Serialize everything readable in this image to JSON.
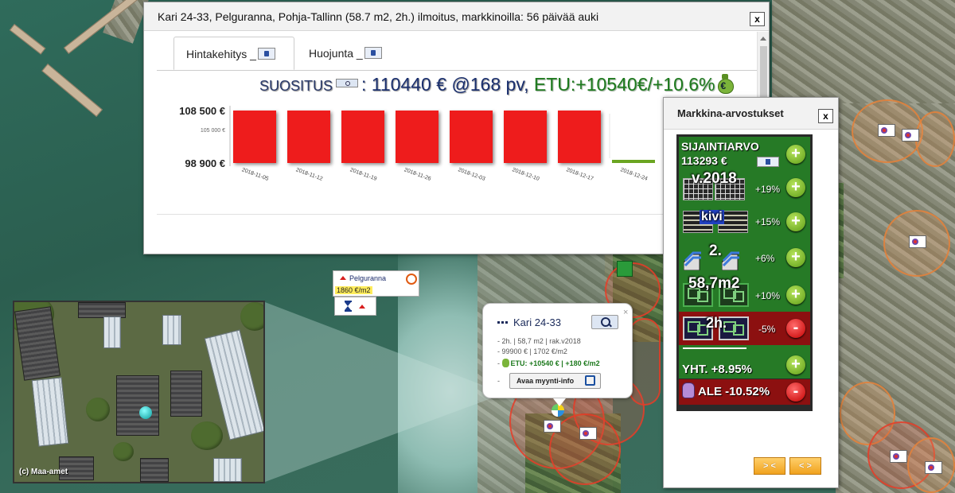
{
  "popup": {
    "title": "Kari 24-33, Pelguranna, Pohja-Tallinn (58.7 m2, 2h.) ilmoitus, markkinoilla: 56 päivää auki",
    "close": "x",
    "tabs": [
      {
        "label": "Hintakehitys _"
      },
      {
        "label": "Huojunta _"
      }
    ],
    "suositus_label": "SUOSITUS",
    "recommendation": "110440 € @168 pv",
    "separator": ",",
    "etu": "ETU:+10540€/+10.6%"
  },
  "chart_data": {
    "type": "bar",
    "categories": [
      "2018-11-05",
      "2018-11-12",
      "2018-11-19",
      "2018-11-26",
      "2018-12-03",
      "2018-12-10",
      "2018-12-17",
      "2018-12-24"
    ],
    "series": [
      {
        "values": [
          108500,
          108500,
          108500,
          108500,
          108500,
          108500,
          108500,
          98900
        ]
      }
    ],
    "ylim": [
      98900,
      108500
    ],
    "ytick_labels": [
      "108 500 €",
      "105 000 €",
      "98 900 €"
    ],
    "ytick_values": [
      108500,
      105000,
      98900
    ],
    "colors": {
      "bar": "#ee1c1c",
      "last_bar": "#6aa521"
    }
  },
  "market": {
    "title": "Markkina-arvostukset",
    "close": "x",
    "sijainti_label": "SIJAINTIARVO",
    "sijainti_value": "113293 €",
    "rows": [
      {
        "badge": "v.2018",
        "pct": "+19%",
        "sign": "+"
      },
      {
        "badge": "kivi",
        "pct": "+15%",
        "sign": "+"
      },
      {
        "badge": "2.",
        "pct": "+6%",
        "sign": "+"
      },
      {
        "badge": "58,7m2",
        "pct": "+10%",
        "sign": "+"
      },
      {
        "badge": "2h.",
        "pct": "-5%",
        "sign": "-"
      }
    ],
    "yht": "YHT. +8.95%",
    "ale": "ALE -10.52%",
    "buttons": [
      "> <",
      "< >"
    ]
  },
  "info": {
    "title": "Kari 24-33",
    "close": "×",
    "line1": "- 2h. | 58,7 m2 | rak.v2018",
    "line2": "- 99900 € | 1702 €/m2",
    "line3_prefix": "-",
    "etu": "ETU: +10540 € | +180 €/m2",
    "line4_prefix": "-",
    "button": "Avaa myynti-info"
  },
  "pelguranna": {
    "name": "Pelguranna",
    "price": "1860 €/m2"
  },
  "photo": {
    "credit": "(c) Maa-amet"
  },
  "icons": {
    "plus": "+",
    "minus": "-",
    "exit_sign": "exit-sign-icon"
  }
}
